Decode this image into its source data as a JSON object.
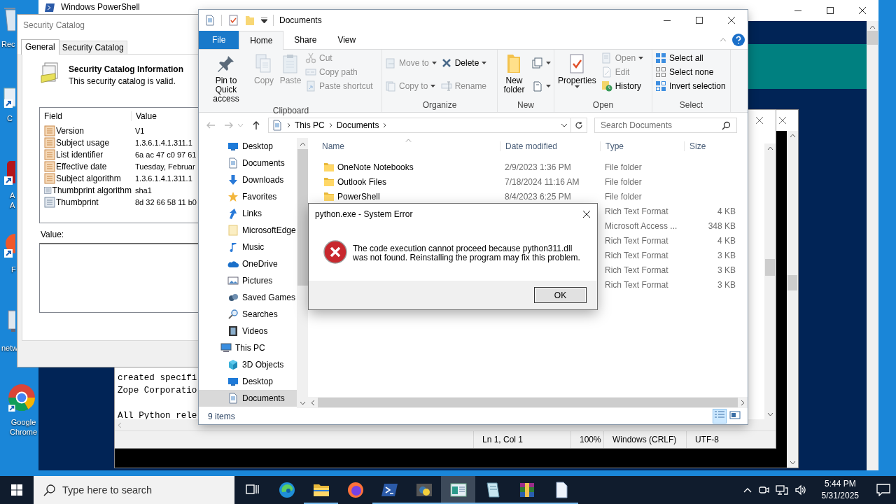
{
  "desktop_icons": [
    {
      "kind": "bin",
      "lines": [
        "Rec"
      ]
    },
    {
      "kind": "app",
      "lines": [
        "C"
      ]
    },
    {
      "kind": "red",
      "lines": [
        "A",
        "A"
      ]
    },
    {
      "kind": "orange",
      "lines": [
        "F"
      ]
    },
    {
      "kind": "network",
      "lines": [
        "netw"
      ]
    },
    {
      "kind": "browser",
      "lines": [
        "Google",
        "Chrome"
      ]
    }
  ],
  "powershell": {
    "title": "Windows PowerShell"
  },
  "notepad": {
    "paragraphs": [
      [
        "created specifi",
        "Zope Corporatio"
      ],
      [
        "All Python rele"
      ]
    ],
    "status": [
      "Ln 1, Col 1",
      "100%",
      "Windows (CRLF)",
      "UTF-8"
    ]
  },
  "security_catalog": {
    "title": "Security Catalog",
    "tabs": [
      {
        "label": "General",
        "selected": true
      },
      {
        "label": "Security Catalog",
        "selected": false
      }
    ],
    "heading": "Security Catalog Information",
    "subtitle": "This security catalog is valid.",
    "columns": [
      "Field",
      "Value"
    ],
    "rows": [
      {
        "kind": "extension",
        "field": "Version",
        "value": "V1"
      },
      {
        "kind": "extension",
        "field": "Subject usage",
        "value": "1.3.6.1.4.1.311.1"
      },
      {
        "kind": "extension",
        "field": "List identifier",
        "value": "6a ac 47 c0 97 61"
      },
      {
        "kind": "extension",
        "field": "Effective date",
        "value": "Tuesday, Februar"
      },
      {
        "kind": "extension",
        "field": "Subject algorithm",
        "value": "1.3.6.1.4.1.311.1"
      },
      {
        "kind": "property",
        "field": "Thumbprint algorithm",
        "value": "sha1"
      },
      {
        "kind": "property",
        "field": "Thumbprint",
        "value": "8d 32 66 58 11 b0"
      }
    ],
    "value_label": "Value:"
  },
  "explorer": {
    "title": "Documents",
    "ribbon_tabs": [
      {
        "kind": "file",
        "label": "File",
        "selected": false
      },
      {
        "kind": "tab",
        "label": "Home",
        "selected": true
      },
      {
        "kind": "tab",
        "label": "Share",
        "selected": false
      },
      {
        "kind": "tab",
        "label": "View",
        "selected": false
      }
    ],
    "groups": [
      {
        "label": "Clipboard",
        "items": [
          {
            "kind": "large",
            "label": "Pin to Quick access",
            "disabled": false,
            "dropdown": false
          },
          {
            "kind": "large",
            "label": "Copy",
            "disabled": true,
            "dropdown": false
          },
          {
            "kind": "large",
            "label": "Paste",
            "disabled": true,
            "dropdown": false
          },
          {
            "kind": "stack",
            "buttons": [
              {
                "kind": "small",
                "label": "Cut",
                "disabled": true,
                "dropdown": false
              },
              {
                "kind": "small",
                "label": "Copy path",
                "disabled": true,
                "dropdown": false
              },
              {
                "kind": "small",
                "label": "Paste shortcut",
                "disabled": true,
                "dropdown": false
              }
            ]
          }
        ]
      },
      {
        "label": "Organize",
        "items": [
          {
            "kind": "stack",
            "buttons": [
              {
                "kind": "small",
                "label": "Move to",
                "disabled": true,
                "dropdown": true
              },
              {
                "kind": "small",
                "label": "Copy to",
                "disabled": true,
                "dropdown": true
              }
            ]
          },
          {
            "kind": "stack",
            "buttons": [
              {
                "kind": "small",
                "label": "Delete",
                "disabled": false,
                "dropdown": true
              },
              {
                "kind": "small",
                "label": "Rename",
                "disabled": true,
                "dropdown": false
              }
            ]
          }
        ]
      },
      {
        "label": "New",
        "items": [
          {
            "kind": "large",
            "label": "New folder",
            "disabled": false,
            "dropdown": false
          },
          {
            "kind": "stack",
            "buttons": [
              {
                "kind": "icon",
                "disabled": false,
                "dropdown": true
              },
              {
                "kind": "icon",
                "disabled": false,
                "dropdown": true
              }
            ]
          }
        ]
      },
      {
        "label": "Open",
        "items": [
          {
            "kind": "large",
            "label": "Properties",
            "disabled": false,
            "dropdown": true
          },
          {
            "kind": "stack",
            "buttons": [
              {
                "kind": "small",
                "label": "Open",
                "disabled": true,
                "dropdown": true
              },
              {
                "kind": "small",
                "label": "Edit",
                "disabled": true,
                "dropdown": false
              },
              {
                "kind": "small",
                "label": "History",
                "disabled": false,
                "dropdown": false
              }
            ]
          }
        ]
      },
      {
        "label": "Select",
        "items": [
          {
            "kind": "stack",
            "buttons": [
              {
                "kind": "small",
                "label": "Select all",
                "disabled": false,
                "dropdown": false
              },
              {
                "kind": "small",
                "label": "Select none",
                "disabled": false,
                "dropdown": false
              },
              {
                "kind": "small",
                "label": "Invert selection",
                "disabled": false,
                "dropdown": false
              }
            ]
          }
        ]
      }
    ],
    "path": [
      "This PC",
      "Documents"
    ],
    "search_placeholder": "Search Documents",
    "nav_tree": [
      {
        "children": [
          {
            "label": "Desktop",
            "selected": false
          },
          {
            "label": "Documents",
            "selected": false
          },
          {
            "label": "Downloads",
            "selected": false
          },
          {
            "label": "Favorites",
            "selected": false
          },
          {
            "label": "Links",
            "selected": false
          },
          {
            "label": "MicrosoftEdge",
            "selected": false
          },
          {
            "label": "Music",
            "selected": false
          },
          {
            "label": "OneDrive",
            "selected": false
          },
          {
            "label": "Pictures",
            "selected": false
          },
          {
            "label": "Saved Games",
            "selected": false
          },
          {
            "label": "Searches",
            "selected": false
          },
          {
            "label": "Videos",
            "selected": false
          }
        ]
      },
      {
        "label": "This PC",
        "selected": false,
        "children": [
          {
            "label": "3D Objects",
            "selected": false
          },
          {
            "label": "Desktop",
            "selected": false
          },
          {
            "label": "Documents",
            "selected": true
          }
        ]
      }
    ],
    "columns": [
      "Name",
      "Date modified",
      "Type",
      "Size"
    ],
    "files": [
      {
        "kind": "folder",
        "name": "OneNote Notebooks",
        "date": "2/9/2023 1:36 PM",
        "type": "File folder"
      },
      {
        "kind": "folder",
        "name": "Outlook Files",
        "date": "7/18/2024 11:16 AM",
        "type": "File folder"
      },
      {
        "kind": "folder",
        "name": "PowerShell",
        "date": "8/4/2023 6:25 PM",
        "type": "File folder"
      },
      {
        "type": "Rich Text Format",
        "size": "4 KB"
      },
      {
        "type": "Microsoft Access ...",
        "size": "348 KB"
      },
      {
        "type": "Rich Text Format",
        "size": "4 KB"
      },
      {
        "type": "Rich Text Format",
        "size": "3 KB"
      },
      {
        "type": "Rich Text Format",
        "size": "3 KB"
      },
      {
        "type": "Rich Text Format",
        "size": "3 KB"
      }
    ],
    "status": "9 items"
  },
  "error_dialog": {
    "title": "python.exe - System Error",
    "message_lines": [
      "The code execution cannot proceed because python311.dll",
      "was not found. Reinstalling the program may fix this problem."
    ],
    "button": "OK"
  },
  "taskbar": {
    "search_placeholder": "Type here to search",
    "apps": [
      {
        "kind": "taskview",
        "running": false,
        "active": false
      },
      {
        "kind": "edge",
        "running": false,
        "active": false
      },
      {
        "kind": "folder",
        "running": true,
        "active": false
      },
      {
        "kind": "firefox",
        "running": false,
        "active": false
      },
      {
        "kind": "terminal",
        "running": true,
        "active": false
      },
      {
        "kind": "python",
        "running": true,
        "active": false
      },
      {
        "kind": "window",
        "running": true,
        "active": true
      },
      {
        "kind": "notepad",
        "running": true,
        "active": false
      },
      {
        "kind": "archive",
        "running": true,
        "active": false
      },
      {
        "kind": "file",
        "running": true,
        "active": false
      }
    ],
    "time": "5:44 PM",
    "date": "5/31/2025"
  }
}
